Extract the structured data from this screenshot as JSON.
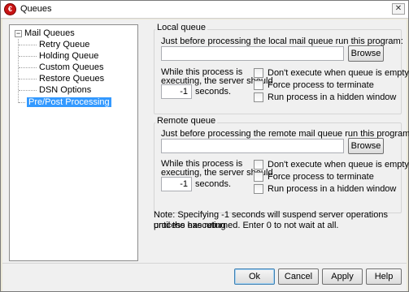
{
  "window": {
    "title": "Queues",
    "close_glyph": "✕",
    "app_icon_glyph": "€"
  },
  "tree": {
    "root": {
      "label": "Mail Queues",
      "expander": "−"
    },
    "children": [
      {
        "label": "Retry Queue"
      },
      {
        "label": "Holding Queue"
      },
      {
        "label": "Custom Queues"
      },
      {
        "label": "Restore Queues"
      },
      {
        "label": "DSN Options"
      }
    ],
    "selected": {
      "label": "Pre/Post Processing"
    }
  },
  "local_queue": {
    "title": "Local queue",
    "prompt": "Just before processing the local mail queue run this program:",
    "program_value": "",
    "browse_label": "Browse",
    "while_label_1": "While this process is",
    "while_label_2": "executing, the server should",
    "seconds_value": "-1",
    "seconds_label": "seconds.",
    "opt_dont_execute": "Don't execute when queue is empty",
    "opt_force_terminate": "Force process to terminate",
    "opt_hidden_window": "Run process in a hidden window"
  },
  "remote_queue": {
    "title": "Remote queue",
    "prompt": "Just before processing the remote mail queue run this program:",
    "program_value": "",
    "browse_label": "Browse",
    "while_label_1": "While this process is",
    "while_label_2": "executing, the server should",
    "seconds_value": "-1",
    "seconds_label": "seconds.",
    "opt_dont_execute": "Don't execute when queue is empty",
    "opt_force_terminate": "Force process to terminate",
    "opt_hidden_window": "Run process in a hidden window"
  },
  "note": {
    "line1": "Note:  Specifying -1 seconds will suspend server operations until the executing",
    "line2": "process has returned.  Enter 0 to not wait at all."
  },
  "buttons": {
    "ok": "Ok",
    "cancel": "Cancel",
    "apply": "Apply",
    "help": "Help"
  }
}
